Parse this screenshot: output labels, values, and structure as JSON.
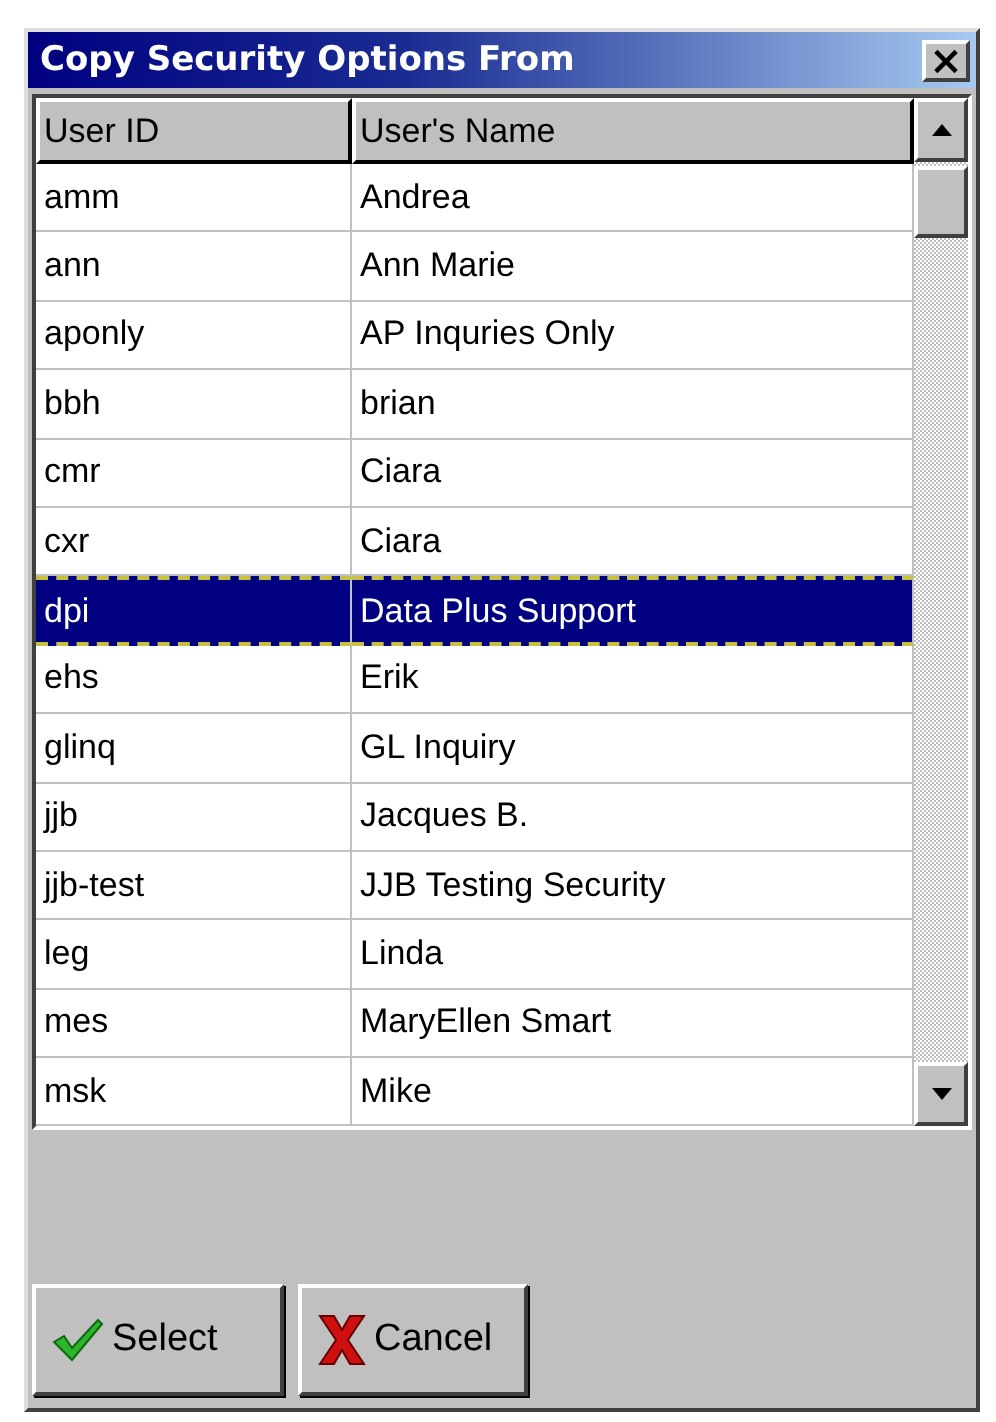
{
  "window": {
    "title": "Copy Security Options From",
    "close": "×"
  },
  "table": {
    "columns": [
      "User ID",
      "User's Name"
    ],
    "rows": [
      {
        "id": "amm",
        "name": "Andrea",
        "selected": false
      },
      {
        "id": "ann",
        "name": "Ann Marie",
        "selected": false
      },
      {
        "id": "aponly",
        "name": "AP  Inquries Only",
        "selected": false
      },
      {
        "id": "bbh",
        "name": "brian",
        "selected": false
      },
      {
        "id": "cmr",
        "name": "Ciara",
        "selected": false
      },
      {
        "id": "cxr",
        "name": "Ciara",
        "selected": false
      },
      {
        "id": "dpi",
        "name": "Data Plus Support",
        "selected": true
      },
      {
        "id": "ehs",
        "name": "Erik",
        "selected": false
      },
      {
        "id": "glinq",
        "name": "GL Inquiry",
        "selected": false
      },
      {
        "id": "jjb",
        "name": "Jacques B.",
        "selected": false
      },
      {
        "id": "jjb-test",
        "name": "JJB Testing Security",
        "selected": false
      },
      {
        "id": "leg",
        "name": "Linda",
        "selected": false
      },
      {
        "id": "mes",
        "name": "MaryEllen Smart",
        "selected": false
      },
      {
        "id": "msk",
        "name": "Mike",
        "selected": false
      }
    ]
  },
  "buttons": [
    {
      "kind": "ok",
      "label": "Select"
    },
    {
      "kind": "cancel",
      "label": "Cancel"
    }
  ]
}
